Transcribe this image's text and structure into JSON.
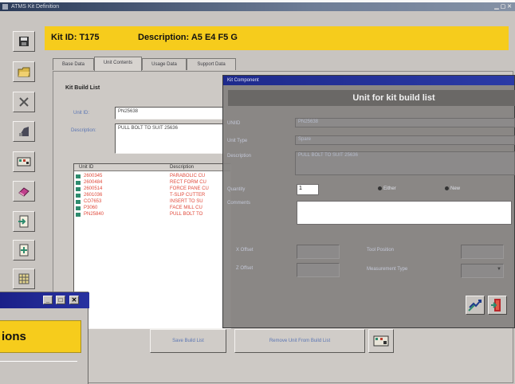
{
  "window": {
    "title": "ATMS Kit Definition",
    "controls": "▁ ▢ ✕"
  },
  "toolbar": {
    "icons": [
      "save-icon",
      "open-folder-icon",
      "cancel-icon",
      "chart-icon",
      "kit-icon",
      "eraser-icon",
      "import-icon",
      "add-component-icon",
      "grid-icon"
    ]
  },
  "header": {
    "kit_id": "Kit ID: T175",
    "description": "Description: A5 E4 F5 G"
  },
  "tabs": [
    "Base Data",
    "Unit Contents",
    "Usage Data",
    "Support Data"
  ],
  "build_list": {
    "group_title": "Kit Build List",
    "unit_id_label": "Unit ID:",
    "unit_id_value": "PN25638",
    "description_label": "Description:",
    "description_value": "PULL BOLT TO SUIT 25636",
    "columns": [
      "Unit ID",
      "Description"
    ],
    "rows": [
      {
        "id": "2600345",
        "desc": "PARABOLIC CU"
      },
      {
        "id": "2600484",
        "desc": "RECT FORM CU"
      },
      {
        "id": "2600514",
        "desc": "FORCE PANE CU"
      },
      {
        "id": "2601036",
        "desc": "T-SLIP CUTTER"
      },
      {
        "id": "CO7653",
        "desc": "INSERT TO SU"
      },
      {
        "id": "P3060",
        "desc": "FACE MILL CU"
      },
      {
        "id": "PN25840",
        "desc": "PULL BOLT TO"
      }
    ]
  },
  "bottom_buttons": {
    "save": "Save Build List",
    "remove": "Remove Unit From Build List"
  },
  "dialog": {
    "title": "Kit Component",
    "banner": "Unit for kit build list",
    "unit_id_label": "UNIID",
    "unit_id_value": "PN25638",
    "unit_type_label": "Unit Type",
    "unit_type_value": "Spare",
    "description_label": "Description",
    "description_value": "PULL BOLT TO SUIT 25636",
    "quantity_label": "Quantity",
    "quantity_value": "1",
    "radio_either": "Either",
    "radio_new": "New",
    "comments_label": "Comments",
    "x_offset_label": "X Offset",
    "z_offset_label": "Z Offset",
    "tool_position_label": "Tool Position",
    "measurement_type_label": "Measurement Type",
    "accent": "#2b3aa6"
  },
  "background_window": {
    "text": "ions",
    "accent": "#f6cc1c"
  }
}
